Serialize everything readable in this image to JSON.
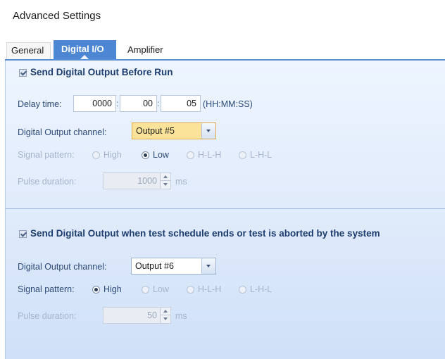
{
  "window": {
    "title": "Advanced Settings"
  },
  "tabs": [
    {
      "label": "General",
      "selected": false
    },
    {
      "label": "Digital I/O",
      "selected": true
    },
    {
      "label": "Amplifier",
      "selected": false
    }
  ],
  "section1": {
    "checkbox_label": "Send Digital Output Before Run",
    "checked": true,
    "delay_label": "Delay time:",
    "delay_hours": "0000",
    "delay_minutes": "00",
    "delay_seconds": "05",
    "delay_sep1": ":",
    "delay_sep2": ":",
    "delay_format": "(HH:MM:SS)",
    "channel_label": "Digital Output channel:",
    "channel_value": "Output #5",
    "pattern_label": "Signal pattern:",
    "patterns": [
      "High",
      "Low",
      "H-L-H",
      "L-H-L"
    ],
    "pattern_selected": "Low",
    "pulse_label": "Pulse duration:",
    "pulse_value": "1000",
    "pulse_unit": "ms"
  },
  "section2": {
    "checkbox_label": "Send Digital Output when test schedule ends or test is aborted by the system",
    "checked": true,
    "channel_label": "Digital Output channel:",
    "channel_value": "Output #6",
    "pattern_label": "Signal pattern:",
    "patterns": [
      "High",
      "Low",
      "H-L-H",
      "L-H-L"
    ],
    "pattern_selected": "High",
    "pulse_label": "Pulse duration:",
    "pulse_value": "50",
    "pulse_unit": "ms"
  },
  "colors": {
    "tab_active": "#4d87d3",
    "panel_bg": "#dde9fa",
    "label_text": "#2c4a78",
    "combo_active": "#fbe49a"
  }
}
